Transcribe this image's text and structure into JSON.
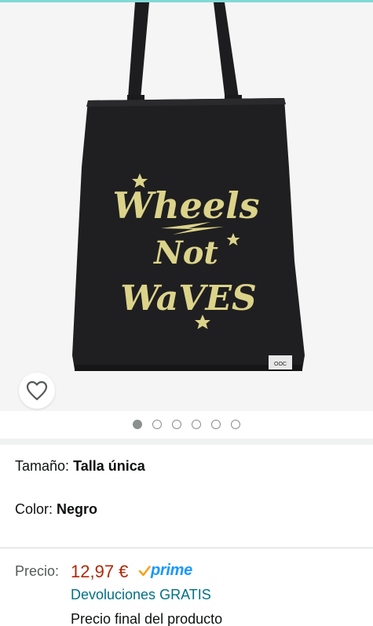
{
  "product": {
    "image_alt": "Bolsa tote negra",
    "print_lines": [
      "Wheels",
      "Not",
      "WaVES"
    ],
    "brand_tag": "OOC"
  },
  "carousel": {
    "total": 6,
    "active_index": 0
  },
  "variations": {
    "size_label": "Tamaño:",
    "size_value": "Talla única",
    "color_label": "Color:",
    "color_value": "Negro"
  },
  "pricing": {
    "label": "Precio:",
    "value": "12,97 €",
    "prime_text": "prime",
    "returns": "Devoluciones GRATIS",
    "final_price": "Precio final del producto"
  },
  "colors": {
    "price": "#b12704",
    "prime": "#1a98ff",
    "link": "#007185",
    "bag": "#1d1d1f",
    "print": "#dcd38a"
  },
  "icons": {
    "favorite": "heart-outline-icon",
    "prime_check": "check-icon"
  }
}
